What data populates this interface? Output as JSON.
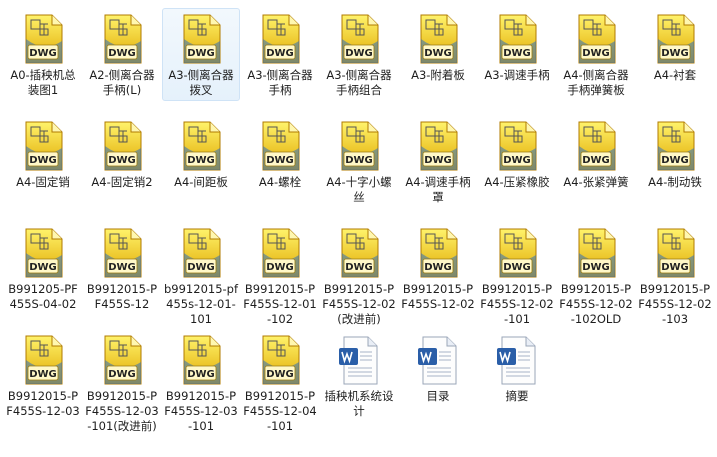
{
  "files": [
    {
      "name": "A0-插秧机总装图1",
      "type": "dwg"
    },
    {
      "name": "A2-侧离合器手柄(L)",
      "type": "dwg"
    },
    {
      "name": "A3-侧离合器拨叉",
      "type": "dwg",
      "selected": true
    },
    {
      "name": "A3-侧离合器手柄",
      "type": "dwg"
    },
    {
      "name": "A3-侧离合器手柄组合",
      "type": "dwg"
    },
    {
      "name": "A3-附着板",
      "type": "dwg"
    },
    {
      "name": "A3-调速手柄",
      "type": "dwg"
    },
    {
      "name": "A4-侧离合器手柄弹簧板",
      "type": "dwg"
    },
    {
      "name": "A4-衬套",
      "type": "dwg"
    },
    {
      "name": "A4-固定销",
      "type": "dwg"
    },
    {
      "name": "A4-固定销2",
      "type": "dwg"
    },
    {
      "name": "A4-间距板",
      "type": "dwg"
    },
    {
      "name": "A4-螺栓",
      "type": "dwg"
    },
    {
      "name": "A4-十字小螺丝",
      "type": "dwg"
    },
    {
      "name": "A4-调速手柄罩",
      "type": "dwg"
    },
    {
      "name": "A4-压紧橡胶",
      "type": "dwg"
    },
    {
      "name": "A4-张紧弹簧",
      "type": "dwg"
    },
    {
      "name": "A4-制动铁",
      "type": "dwg"
    },
    {
      "name": "B991205-PF455S-04-02",
      "type": "dwg"
    },
    {
      "name": "B9912015-PF455S-12",
      "type": "dwg"
    },
    {
      "name": "b9912015-pf455s-12-01-101",
      "type": "dwg"
    },
    {
      "name": "B9912015-PF455S-12-01-102",
      "type": "dwg"
    },
    {
      "name": "B9912015-PF455S-12-02(改进前)",
      "type": "dwg"
    },
    {
      "name": "B9912015-PF455S-12-02",
      "type": "dwg"
    },
    {
      "name": "B9912015-PF455S-12-02-101",
      "type": "dwg"
    },
    {
      "name": "B9912015-PF455S-12-02-102OLD",
      "type": "dwg"
    },
    {
      "name": "B9912015-PF455S-12-02-103",
      "type": "dwg"
    },
    {
      "name": "B9912015-PF455S-12-03",
      "type": "dwg"
    },
    {
      "name": "B9912015-PF455S-12-03-101(改进前)",
      "type": "dwg"
    },
    {
      "name": "B9912015-PF455S-12-03-101",
      "type": "dwg"
    },
    {
      "name": "B9912015-PF455S-12-04-101",
      "type": "dwg"
    },
    {
      "name": "插秧机系统设计",
      "type": "doc"
    },
    {
      "name": "目录",
      "type": "doc"
    },
    {
      "name": "摘要",
      "type": "doc"
    }
  ],
  "badge": {
    "dwg": "DWG"
  },
  "colors": {
    "dwg_top": "#fff36b",
    "dwg_bottom": "#e0a800",
    "doc_blue": "#2a5ea8",
    "selection": "#e5f1fb"
  }
}
